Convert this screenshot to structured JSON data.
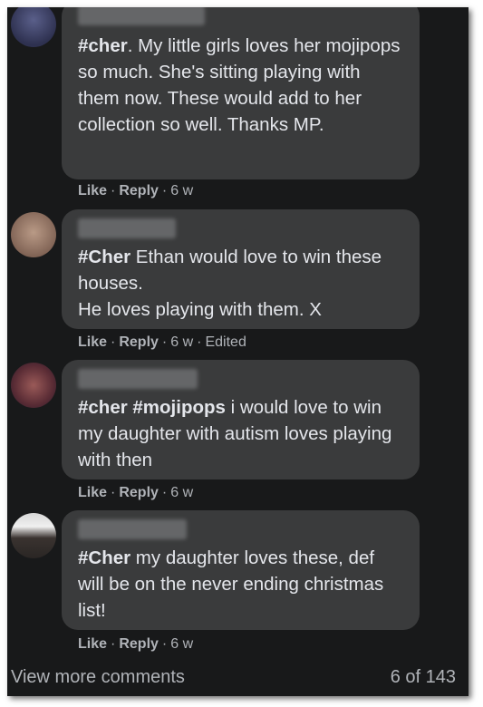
{
  "comments": [
    {
      "hashtags": "#cher",
      "body": ". My little girls loves her mojipops so much. She's sitting playing with them now. These would add to her collection so well. Thanks MP.",
      "like": "Like",
      "reply": "Reply",
      "time": "6 w",
      "edited": ""
    },
    {
      "hashtags": "#Cher",
      "body": " Ethan would love to win these houses.\nHe loves playing with them. X",
      "like": "Like",
      "reply": "Reply",
      "time": "6 w",
      "edited": "Edited"
    },
    {
      "hashtags": "#cher #mojipops",
      "body": " i would love to win my daughter with autism loves playing with then",
      "like": "Like",
      "reply": "Reply",
      "time": "6 w",
      "edited": ""
    },
    {
      "hashtags": "#Cher",
      "body": " my daughter loves these, def will be on the never ending christmas list!",
      "like": "Like",
      "reply": "Reply",
      "time": "6 w",
      "edited": ""
    }
  ],
  "footer": {
    "view_more": "View more comments",
    "count": "6 of 143"
  },
  "colors": {
    "background": "#18191a",
    "bubble": "#3a3b3c",
    "text": "#e4e6eb",
    "muted": "#b0b3b8"
  }
}
